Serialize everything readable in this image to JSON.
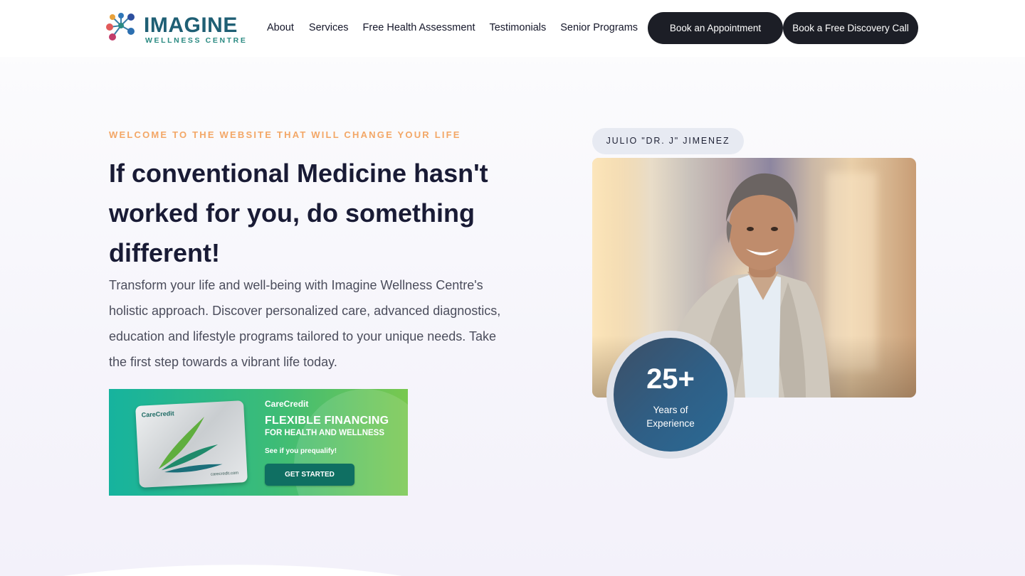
{
  "brand": {
    "name": "IMAGINE",
    "subtitle": "WELLNESS CENTRE",
    "primary_color": "#1f5f74",
    "accent_color": "#2a8a82"
  },
  "nav": {
    "items": [
      {
        "label": "About"
      },
      {
        "label": "Services"
      },
      {
        "label": "Free Health Assessment"
      },
      {
        "label": "Testimonials"
      },
      {
        "label": "Senior Programs"
      }
    ],
    "book_label": "Book an Appointment",
    "call_label": "Book a Free Discovery Call"
  },
  "hero": {
    "eyebrow": "WELCOME TO THE WEBSITE THAT WILL CHANGE YOUR LIFE",
    "headline": "If conventional Medicine hasn't worked for you, do something different!",
    "lead": "Transform your life and well-being with Imagine Wellness Centre's holistic approach. Discover personalized care, advanced diagnostics, education and lifestyle programs tailored to your unique needs. Take the first step towards a vibrant life today.",
    "eyebrow_color": "#f3a766"
  },
  "carecredit": {
    "brand": "CareCredit",
    "card_brand": "CareCredit",
    "card_url": "carecredit.com",
    "title": "FLEXIBLE FINANCING",
    "subtitle": "FOR HEALTH AND WELLNESS",
    "prequalify": "See if you prequalify!",
    "cta": "GET STARTED"
  },
  "doctor": {
    "name": "JULIO \"DR. J\" JIMENEZ",
    "experience_value": "25+",
    "experience_label_line1": "Years of",
    "experience_label_line2": "Experience"
  },
  "icons": [
    "logo-molecule-icon",
    "carecredit-swoosh-icon"
  ]
}
